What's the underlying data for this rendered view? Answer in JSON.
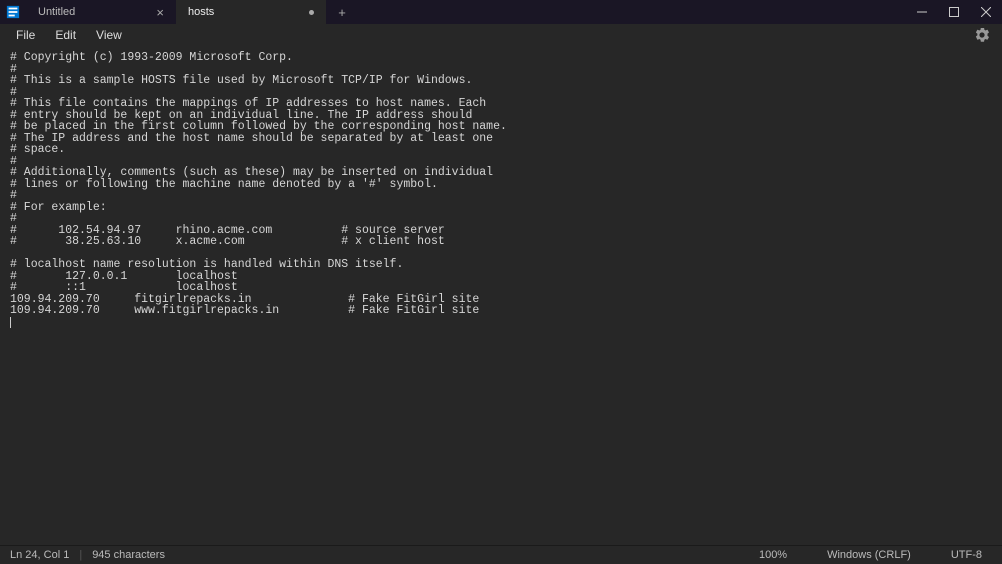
{
  "tabs": [
    {
      "label": "Untitled",
      "active": false,
      "modified": false
    },
    {
      "label": "hosts",
      "active": true,
      "modified": true
    }
  ],
  "newtab_glyph": "+",
  "menubar": {
    "items": [
      "File",
      "Edit",
      "View"
    ]
  },
  "editor": {
    "lines": [
      "# Copyright (c) 1993-2009 Microsoft Corp.",
      "#",
      "# This is a sample HOSTS file used by Microsoft TCP/IP for Windows.",
      "#",
      "# This file contains the mappings of IP addresses to host names. Each",
      "# entry should be kept on an individual line. The IP address should",
      "# be placed in the first column followed by the corresponding host name.",
      "# The IP address and the host name should be separated by at least one",
      "# space.",
      "#",
      "# Additionally, comments (such as these) may be inserted on individual",
      "# lines or following the machine name denoted by a '#' symbol.",
      "#",
      "# For example:",
      "#",
      "#      102.54.94.97     rhino.acme.com          # source server",
      "#       38.25.63.10     x.acme.com              # x client host",
      "",
      "# localhost name resolution is handled within DNS itself.",
      "#       127.0.0.1       localhost",
      "#       ::1             localhost",
      "109.94.209.70     fitgirlrepacks.in              # Fake FitGirl site",
      "109.94.209.70     www.fitgirlrepacks.in          # Fake FitGirl site",
      ""
    ]
  },
  "statusbar": {
    "position": "Ln 24, Col 1",
    "characters": "945 characters",
    "zoom": "100%",
    "line_ending": "Windows (CRLF)",
    "encoding": "UTF-8"
  }
}
